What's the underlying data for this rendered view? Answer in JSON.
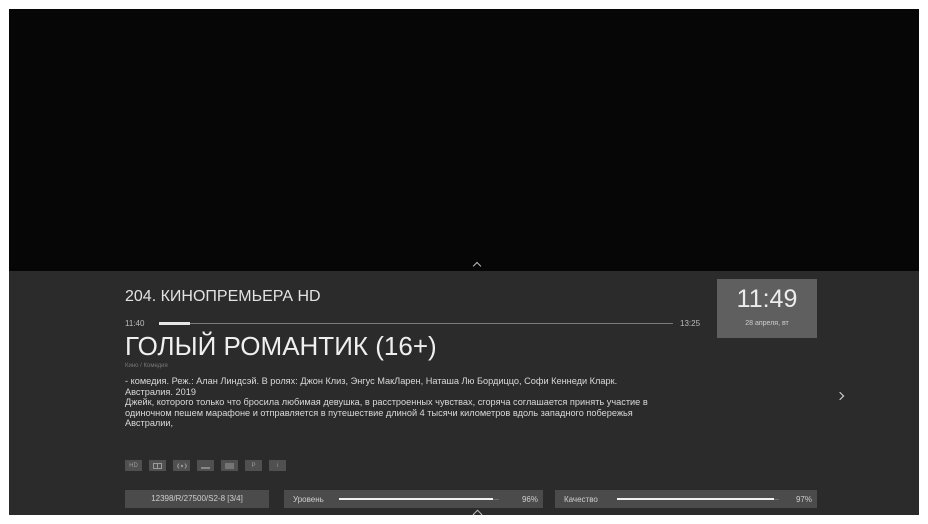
{
  "channel": {
    "name": "204. КИНОПРЕМЬЕРА HD"
  },
  "program": {
    "start_time": "11:40",
    "end_time": "13:25",
    "progress_fraction": 0.06,
    "title": "ГОЛЫЙ РОМАНТИК (16+)",
    "genre": "Кино / Комедия",
    "description_lines": [
      "- комедия.  Реж.: Алан Линдсэй.  В ролях: Джон Клиз, Энгус МакЛарен, Наташа Лю Бордиццо, Софи Кеннеди Кларк.",
      "Австралия. 2019",
      "Джейк, которого только что бросила любимая девушка, в расстроенных чувствах, сгоряча соглашается принять участие в",
      "одиночном пешем марафоне и отправляется в путешествие длиной 4 тысячи километров вдоль западного побережья",
      "Австралии,"
    ]
  },
  "clock": {
    "time": "11:49",
    "date": "28 апреля, вт"
  },
  "badges": [
    {
      "icon": "hd-icon",
      "label": "HD"
    },
    {
      "icon": "subtitles-icon",
      "label": ""
    },
    {
      "icon": "audio-icon",
      "label": ""
    },
    {
      "icon": "teletext-icon",
      "label": ""
    },
    {
      "icon": "list-icon",
      "label": ""
    },
    {
      "icon": "parental-icon",
      "label": "P"
    },
    {
      "icon": "info-icon",
      "label": "i"
    }
  ],
  "signal": {
    "transponder": "12398/R/27500/S2-8 [3/4]",
    "level_label": "Уровень",
    "level_percent": 96,
    "level_value": "96%",
    "quality_label": "Качество",
    "quality_percent": 97,
    "quality_value": "97%"
  },
  "colors": {
    "panel": "#2b2b2b",
    "clock_box": "#5f5f5f",
    "video": "#060606"
  }
}
